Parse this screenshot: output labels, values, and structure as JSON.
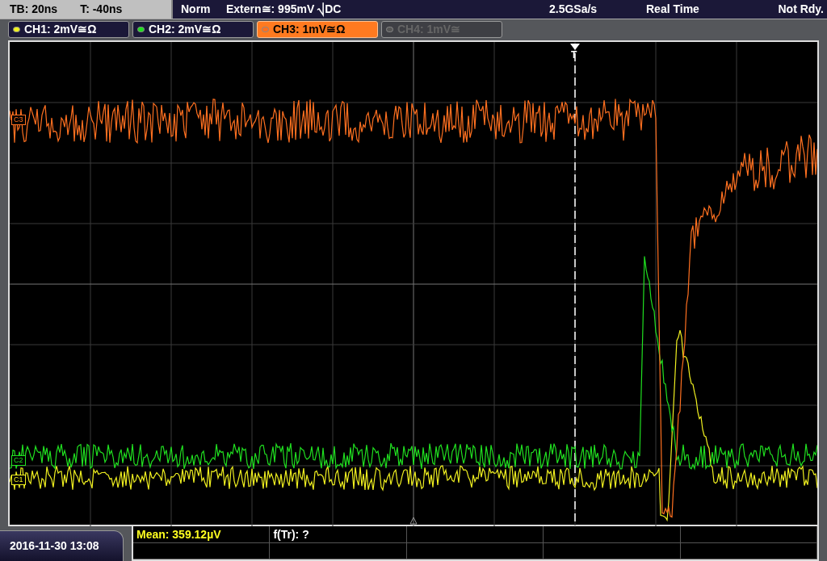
{
  "top_bar": {
    "timebase": "TB: 20ns",
    "trigger_time": "T: -40ns",
    "mode": "Norm",
    "trigger_source": "Extern≅: 995mV ⎷DC",
    "sample_rate": "2.5GSa/s",
    "acquisition": "Real Time",
    "status": "Not Rdy."
  },
  "channels": [
    {
      "label": "CH1: 2mV≅Ω",
      "color": "#f0f020",
      "selected": false,
      "disabled": false
    },
    {
      "label": "CH2: 2mV≅Ω",
      "color": "#20e020",
      "selected": false,
      "disabled": false
    },
    {
      "label": "CH3: 1mV≅Ω",
      "color": "#ff7020",
      "selected": true,
      "disabled": false
    },
    {
      "label": "CH4: 1mV≅",
      "color": "#555555",
      "selected": false,
      "disabled": true
    }
  ],
  "markers": [
    {
      "label": "C3",
      "color": "#ff7020"
    },
    {
      "label": "C2",
      "color": "#20e020"
    },
    {
      "label": "C1",
      "color": "#f0f020"
    }
  ],
  "trigger": {
    "label": "T"
  },
  "date": "2016-11-30 13:08",
  "measurements": [
    {
      "text": "Mean: 359.12µV",
      "highlighted": true
    },
    {
      "text": "f(Tr): ?",
      "highlighted": false
    }
  ]
}
